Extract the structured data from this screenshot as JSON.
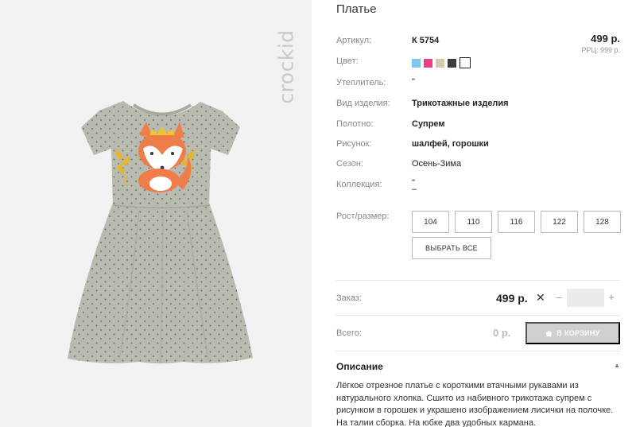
{
  "brand": {
    "logo_text": "crockid"
  },
  "product": {
    "title": "Платье",
    "price": "499 р.",
    "rrp": "РРЦ: 999 р."
  },
  "fields": {
    "article": {
      "label": "Артикул:",
      "value": "К 5754"
    },
    "color": {
      "label": "Цвет:"
    },
    "insulation": {
      "label": "Утеплитель:",
      "value": "\""
    },
    "item_type": {
      "label": "Вид изделия:",
      "value": "Трикотажные изделия"
    },
    "fabric": {
      "label": "Полотно:",
      "value": "Супрем"
    },
    "print": {
      "label": "Рисунок:",
      "value": "шалфей, горошки"
    },
    "season": {
      "label": "Сезон:",
      "value": "Осень-Зима"
    },
    "collection": {
      "label": "Коллекция:",
      "value1": "\"",
      "value2": "–"
    },
    "size": {
      "label": "Рост/размер:"
    }
  },
  "colors": [
    "#7ec8f0",
    "#e8417f",
    "#d6c9b2",
    "#3c3c3c"
  ],
  "sizes": [
    "104",
    "110",
    "116",
    "122",
    "128"
  ],
  "select_all_label": "ВЫБРАТЬ ВСЕ",
  "order": {
    "label": "Заказ:",
    "price": "499 р.",
    "remove_glyph": "✕",
    "minus": "–",
    "plus": "+",
    "quantity": ""
  },
  "total": {
    "label": "Всего:",
    "value": "0 р.",
    "cart_button": "В КОРЗИНУ"
  },
  "description": {
    "title": "Описание",
    "toggle_glyph": "▲",
    "text": "Лёгкое отрезное платье с короткими втачными рукавами из натурального хлопка. Сшито из набивного трикотажа супрем с рисунком в горошек и украшено изображением лисички на полочке. На талии сборка. На юбке два удобных кармана."
  },
  "theme": {
    "panel_bg": "#f2f2f2",
    "dress_color": "#b9bbaf",
    "fox_orange": "#ef7d4a",
    "button_disabled": "#d0d0d0"
  }
}
